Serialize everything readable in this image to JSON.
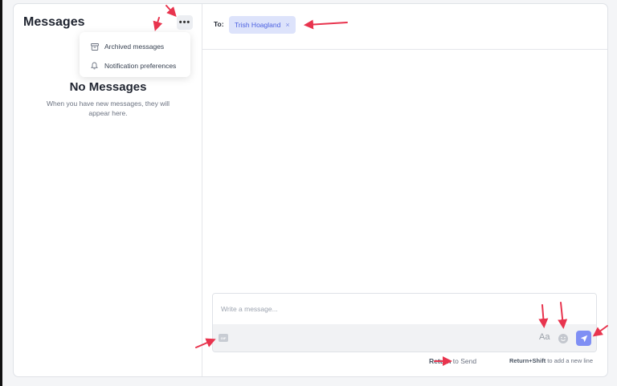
{
  "sidebar": {
    "title": "Messages",
    "more_label": "•••",
    "menu": [
      {
        "label": "Archived messages",
        "icon": "archive-icon"
      },
      {
        "label": "Notification preferences",
        "icon": "bell-icon"
      }
    ],
    "empty_title": "No Messages",
    "empty_description": "When you have new messages, they will appear here."
  },
  "conversation": {
    "to_label": "To:",
    "recipient": "Trish Hoagland",
    "remove_symbol": "×"
  },
  "composer": {
    "placeholder": "Write a message...",
    "gif_label": "GIF",
    "format_label": "Aa",
    "send_icon": "send-icon",
    "emoji_icon": "emoji-icon"
  },
  "hints": {
    "return_key": "Return",
    "return_text": " to Send",
    "shift_key": "Return+Shift",
    "shift_text": " to add a new line"
  },
  "colors": {
    "accent": "#7f8ff4",
    "chip_bg": "#dde3fb",
    "chip_text": "#4a5fe0",
    "annotation_arrow": "#e8344e"
  }
}
